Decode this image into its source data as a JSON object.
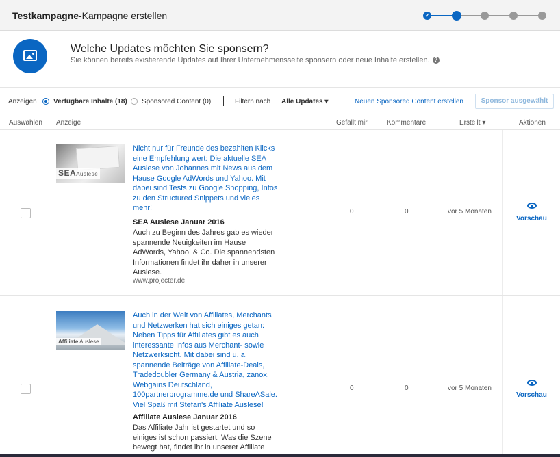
{
  "header": {
    "title_bold": "Testkampagne",
    "title_rest": "-Kampagne erstellen",
    "steps": [
      "done",
      "active",
      "pending",
      "pending",
      "pending"
    ],
    "accent": "#0a66c2"
  },
  "intro": {
    "icon": "image-icon",
    "title": "Welche Updates möchten Sie sponsern?",
    "subtitle": "Sie können bereits existierende Updates auf Ihrer Unternehmensseite sponsern oder neue Inhalte erstellen.",
    "help": "?"
  },
  "toolbar": {
    "show_label": "Anzeigen",
    "available_label": "Verfügbare Inhalte (18)",
    "sponsored_label": "Sponsored Content (0)",
    "filter_label": "Filtern nach",
    "filter_value": "Alle Updates",
    "filter_caret": "▾",
    "new_content_link": "Neuen Sponsored Content erstellen",
    "sponsor_button": "Sponsor ausgewählt"
  },
  "columns": {
    "select": "Auswählen",
    "ad": "Anzeige",
    "likes": "Gefällt mir",
    "comments": "Kommentare",
    "created": "Erstellt",
    "created_caret": "▾",
    "actions": "Aktionen"
  },
  "rows": [
    {
      "thumb_label_big": "SEA",
      "thumb_label_small": "Auslese",
      "text": "Nicht nur für Freunde des bezahlten Klicks eine Empfehlung wert: Die aktuelle SEA Auslese von Johannes mit News aus dem Hause Google AdWords und Yahoo. Mit dabei sind Tests zu Google Shopping, Infos zu den Structured Snippets und vieles mehr!",
      "title": "SEA Auslese Januar 2016",
      "desc": "Auch zu Beginn des Jahres gab es wieder spannende Neuigkeiten im Hause AdWords, Yahoo! & Co. Die spannendsten Informationen findet ihr daher in unserer Auslese.",
      "url": "www.projecter.de",
      "likes": "0",
      "comments": "0",
      "created": "vor 5 Monaten",
      "action": "Vorschau"
    },
    {
      "thumb_label_big": "Affiliate",
      "thumb_label_small": "Auslese",
      "text": "Auch in der Welt von Affiliates, Merchants und Netzwerken hat sich einiges getan: Neben Tipps für Affiliates gibt es auch interessante Infos aus Merchant- sowie Netzwerksicht. Mit dabei sind u. a. spannende Beiträge von Affiliate-Deals, Tradedoubler Germany & Austria, zanox, Webgains Deutschland, 100partnerprogramme.de und ShareASale. Viel Spaß mit Stefan's Affiliate Auslese!",
      "title": "Affiliate Auslese Januar 2016",
      "desc": "Das Affiliate Jahr ist gestartet und so einiges ist schon passiert. Was die Szene bewegt hat, findet ihr in unserer Affiliate",
      "likes": "0",
      "comments": "0",
      "created": "vor 5 Monaten",
      "action": "Vorschau"
    }
  ]
}
